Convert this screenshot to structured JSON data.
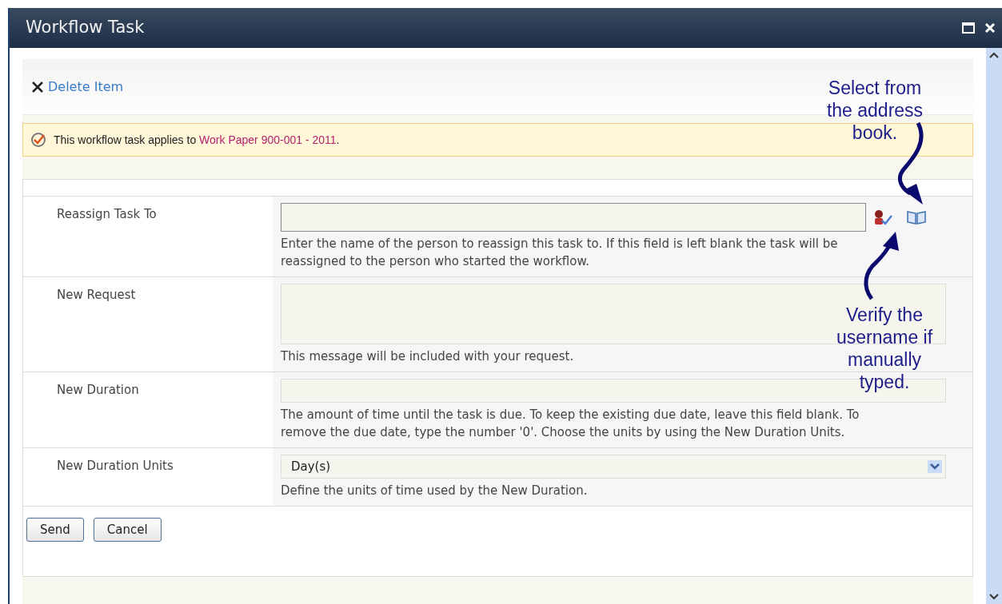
{
  "window": {
    "title": "Workflow Task"
  },
  "toolbar": {
    "delete_label": "Delete Item"
  },
  "notice": {
    "text": "This workflow task applies to ",
    "link": "Work Paper 900-001 - 2011",
    "end": "."
  },
  "fields": [
    {
      "kind": "people",
      "label": "Reassign Task To",
      "help": "Enter the name of the person to reassign this task to. If this field is left blank the task will be reassigned to the person who started the workflow."
    },
    {
      "kind": "textarea",
      "label": "New Request",
      "help": "This message will be included with your request."
    },
    {
      "kind": "text",
      "label": "New Duration",
      "help": "The amount of time until the task is due. To keep the existing due date, leave this field blank. To remove the due date, type the number '0'. Choose the units by using the New Duration Units."
    },
    {
      "kind": "select",
      "label": "New Duration Units",
      "value": "Day(s)",
      "help": "Define the units of time used by the New Duration."
    }
  ],
  "buttons": [
    "Send",
    "Cancel"
  ],
  "callouts": [
    {
      "text": "Select from the address book."
    },
    {
      "text": "Verify the username if manually typed."
    }
  ]
}
